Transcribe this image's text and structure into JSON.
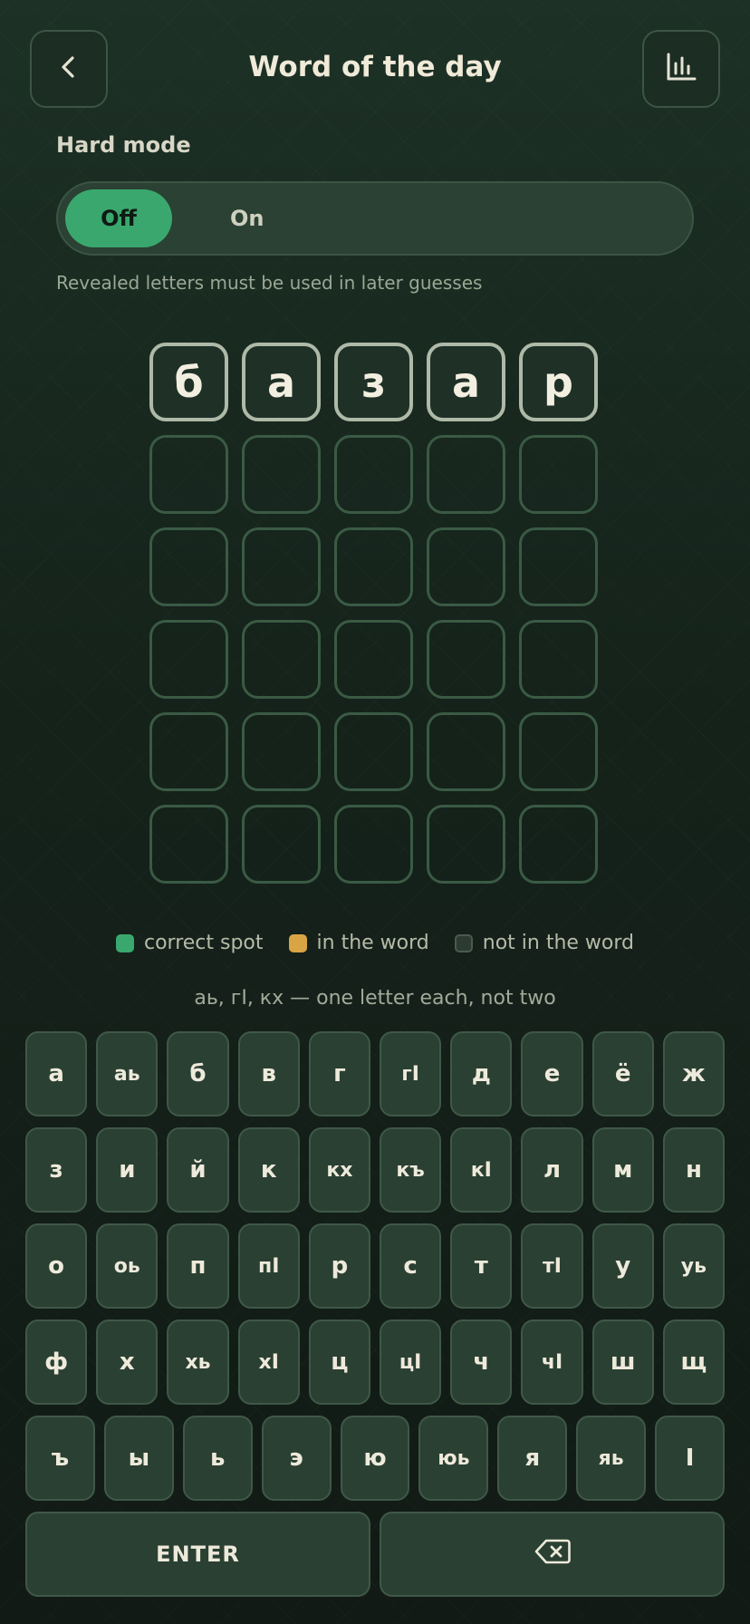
{
  "header": {
    "title": "Word of the day",
    "back_icon": "chevron-left-icon",
    "stats_icon": "bar-chart-icon"
  },
  "hard_mode": {
    "label": "Hard mode",
    "off_label": "Off",
    "on_label": "On",
    "selected": "Off",
    "help_text": "Revealed letters must be used in later guesses"
  },
  "grid": {
    "rows": [
      [
        "б",
        "а",
        "з",
        "а",
        "р"
      ],
      [
        "",
        "",
        "",
        "",
        ""
      ],
      [
        "",
        "",
        "",
        "",
        ""
      ],
      [
        "",
        "",
        "",
        "",
        ""
      ],
      [
        "",
        "",
        "",
        "",
        ""
      ],
      [
        "",
        "",
        "",
        "",
        ""
      ]
    ]
  },
  "legend": [
    {
      "label": "correct spot",
      "color": "#3aa86e"
    },
    {
      "label": "in the word",
      "color": "#d9a443"
    },
    {
      "label": "not in the word",
      "color": "#2c3a31"
    }
  ],
  "hint": "аь, гӀ, кх — one letter each, not two",
  "keyboard": {
    "rows": [
      [
        "а",
        "аь",
        "б",
        "в",
        "г",
        "гӀ",
        "д",
        "е",
        "ё",
        "ж"
      ],
      [
        "з",
        "и",
        "й",
        "к",
        "кх",
        "къ",
        "кӀ",
        "л",
        "м",
        "н"
      ],
      [
        "о",
        "оь",
        "п",
        "пӀ",
        "р",
        "с",
        "т",
        "тӀ",
        "у",
        "уь"
      ],
      [
        "ф",
        "х",
        "хь",
        "хӀ",
        "ц",
        "цӀ",
        "ч",
        "чӀ",
        "ш",
        "щ"
      ],
      [
        "ъ",
        "ы",
        "ь",
        "э",
        "ю",
        "юь",
        "я",
        "яь",
        "Ӏ"
      ]
    ],
    "enter_label": "ENTER",
    "backspace_icon": "backspace-icon"
  }
}
